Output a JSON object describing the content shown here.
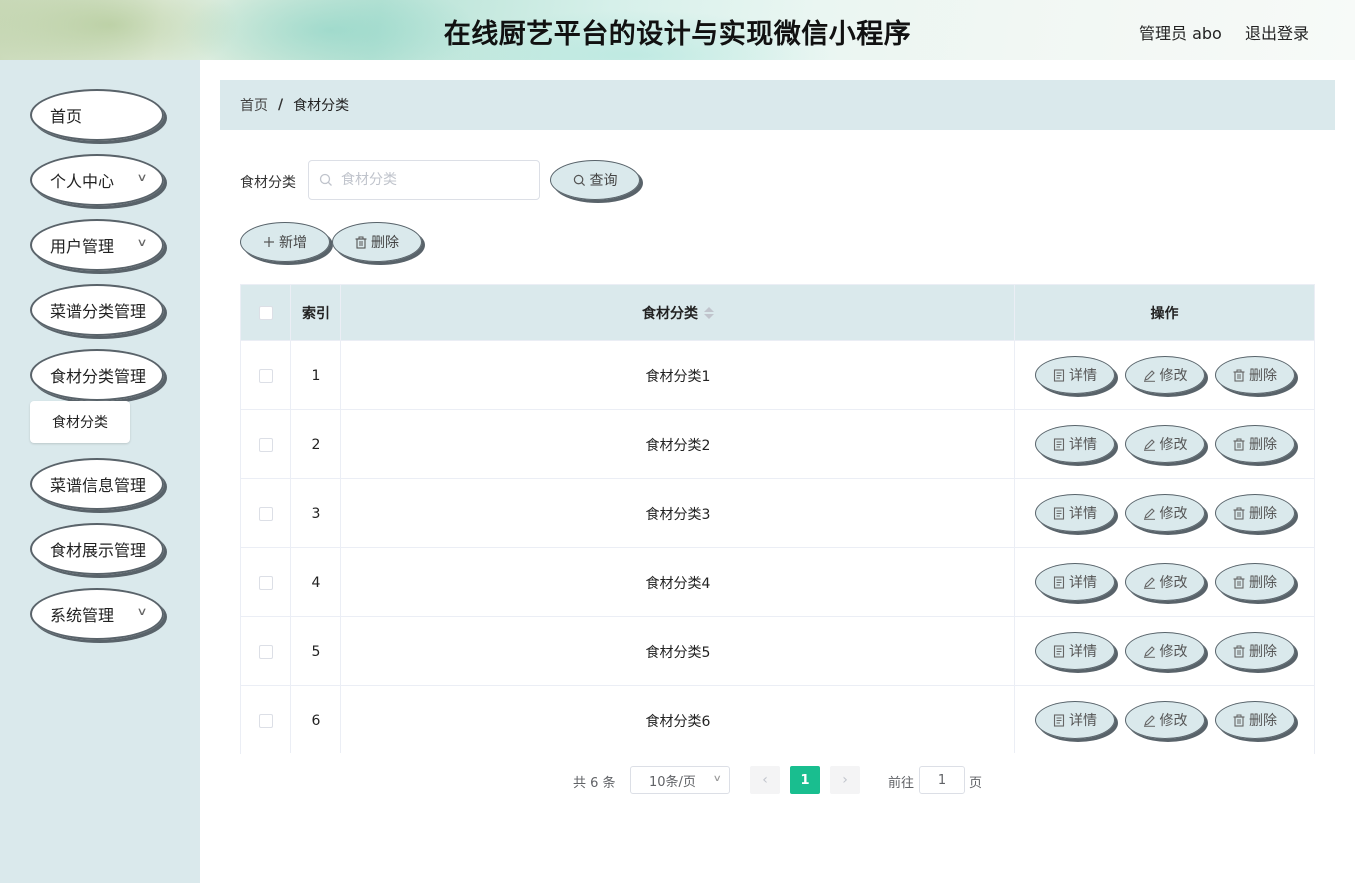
{
  "header": {
    "title": "在线厨艺平台的设计与实现微信小程序",
    "user": "管理员 abo",
    "logout": "退出登录"
  },
  "sidebar": {
    "items": [
      {
        "label": "首页",
        "has_submenu": false
      },
      {
        "label": "个人中心",
        "has_submenu": true
      },
      {
        "label": "用户管理",
        "has_submenu": true
      },
      {
        "label": "菜谱分类管理",
        "has_submenu": false
      },
      {
        "label": "食材分类管理",
        "has_submenu": false
      },
      {
        "label": "菜谱信息管理",
        "has_submenu": false
      },
      {
        "label": "食材展示管理",
        "has_submenu": false
      },
      {
        "label": "系统管理",
        "has_submenu": true
      }
    ],
    "submenu_active": "食材分类"
  },
  "breadcrumb": {
    "home": "首页",
    "separator": "/",
    "current": "食材分类"
  },
  "search": {
    "label": "食材分类",
    "placeholder": "食材分类",
    "value": "",
    "button": "查询"
  },
  "actions": {
    "add": "新增",
    "delete": "删除"
  },
  "table": {
    "columns": {
      "index": "索引",
      "category": "食材分类",
      "operations": "操作"
    },
    "rows": [
      {
        "index": "1",
        "category": "食材分类1"
      },
      {
        "index": "2",
        "category": "食材分类2"
      },
      {
        "index": "3",
        "category": "食材分类3"
      },
      {
        "index": "4",
        "category": "食材分类4"
      },
      {
        "index": "5",
        "category": "食材分类5"
      },
      {
        "index": "6",
        "category": "食材分类6"
      }
    ],
    "row_actions": {
      "detail": "详情",
      "edit": "修改",
      "delete": "删除"
    }
  },
  "pagination": {
    "total": "共 6 条",
    "page_size": "10条/页",
    "current_page": "1",
    "goto_label": "前往",
    "goto_value": "1",
    "goto_unit": "页"
  },
  "colors": {
    "panel": "#dae9ec",
    "accent": "#19be8f",
    "pill_shadow": "#59636a"
  }
}
